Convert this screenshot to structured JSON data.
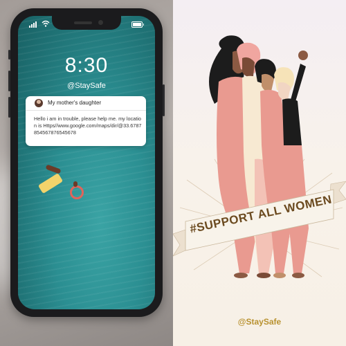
{
  "phone": {
    "lockscreen": {
      "time": "8:30",
      "handle": "@StaySafe"
    },
    "notification": {
      "sender": "My mother's daughter",
      "message": "Hello  i am in trouble, please help me. my location is Https//www.google.com/maps/dir/@33.6787854567876545678"
    }
  },
  "banner": {
    "text": "#SUPPORT ALL WOMEN"
  },
  "footer": {
    "handle": "@StaySafe"
  },
  "colors": {
    "ocean": "#2b8f92",
    "banner_text": "#6b4a1f",
    "handle_gold": "#b8912f",
    "figure_pink": "#e99a90",
    "figure_cream": "#f7e9d2",
    "figure_black": "#1c1c1c"
  }
}
